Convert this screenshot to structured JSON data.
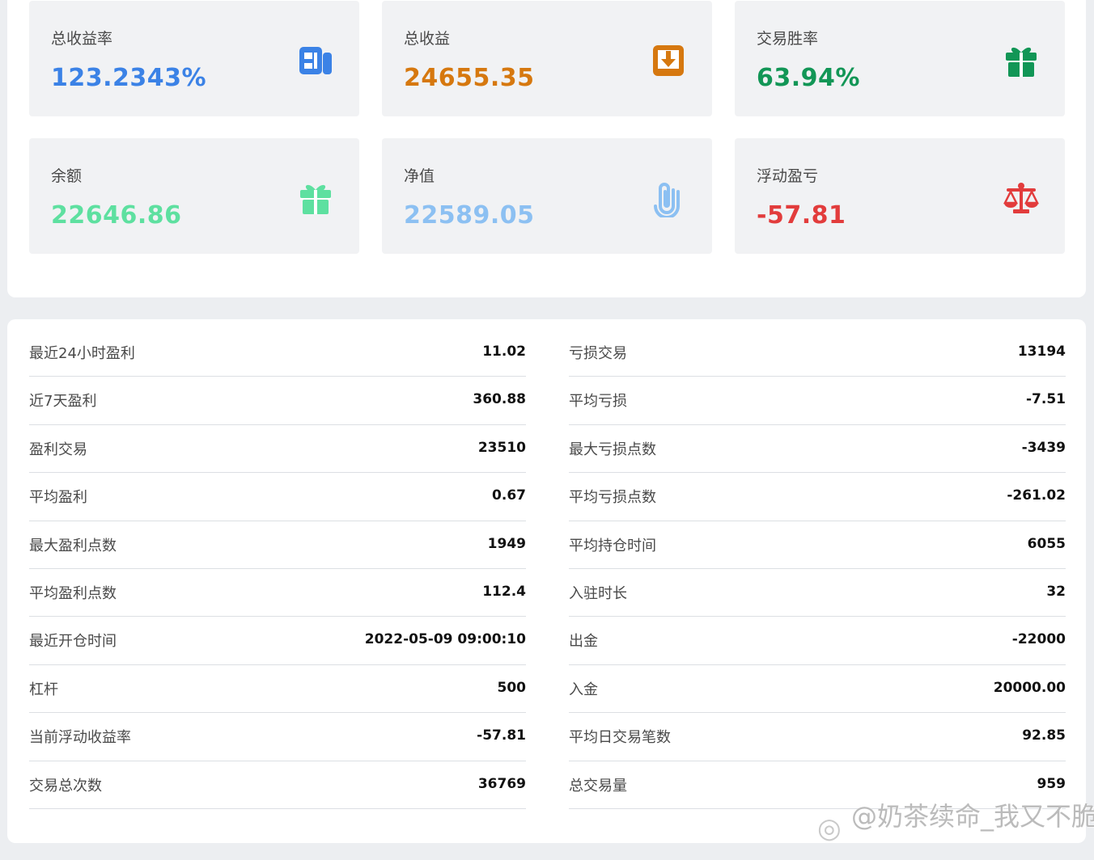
{
  "cards": [
    {
      "title": "总收益率",
      "value": "123.2343%",
      "color": "#3b82e6",
      "icon": "newspaper-icon"
    },
    {
      "title": "总收益",
      "value": "24655.35",
      "color": "#d6780f",
      "icon": "download-tray-icon"
    },
    {
      "title": "交易胜率",
      "value": "63.94%",
      "color": "#129656",
      "icon": "gift-icon"
    },
    {
      "title": "余额",
      "value": "22646.86",
      "color": "#5ee0a0",
      "icon": "gift-icon"
    },
    {
      "title": "净值",
      "value": "22589.05",
      "color": "#8cc0f2",
      "icon": "paperclip-icon"
    },
    {
      "title": "浮动盈亏",
      "value": "-57.81",
      "color": "#e23c3c",
      "icon": "scale-icon"
    }
  ],
  "stats_left": [
    {
      "label": "最近24小时盈利",
      "value": "11.02"
    },
    {
      "label": "近7天盈利",
      "value": "360.88"
    },
    {
      "label": "盈利交易",
      "value": "23510"
    },
    {
      "label": "平均盈利",
      "value": "0.67"
    },
    {
      "label": "最大盈利点数",
      "value": "1949"
    },
    {
      "label": "平均盈利点数",
      "value": "112.4"
    },
    {
      "label": "最近开仓时间",
      "value": "2022-05-09 09:00:10"
    },
    {
      "label": "杠杆",
      "value": "500"
    },
    {
      "label": "当前浮动收益率",
      "value": "-57.81"
    },
    {
      "label": "交易总次数",
      "value": "36769"
    }
  ],
  "stats_right": [
    {
      "label": "亏损交易",
      "value": "13194"
    },
    {
      "label": "平均亏损",
      "value": "-7.51"
    },
    {
      "label": "最大亏损点数",
      "value": "-3439"
    },
    {
      "label": "平均亏损点数",
      "value": "-261.02"
    },
    {
      "label": "平均持仓时间",
      "value": "6055"
    },
    {
      "label": "入驻时长",
      "value": "32"
    },
    {
      "label": "出金",
      "value": "-22000"
    },
    {
      "label": "入金",
      "value": "20000.00"
    },
    {
      "label": "平均日交易笔数",
      "value": "92.85"
    },
    {
      "label": "总交易量",
      "value": "959"
    }
  ],
  "watermark": {
    "text": "@奶茶续命_我又不脆弱_"
  }
}
